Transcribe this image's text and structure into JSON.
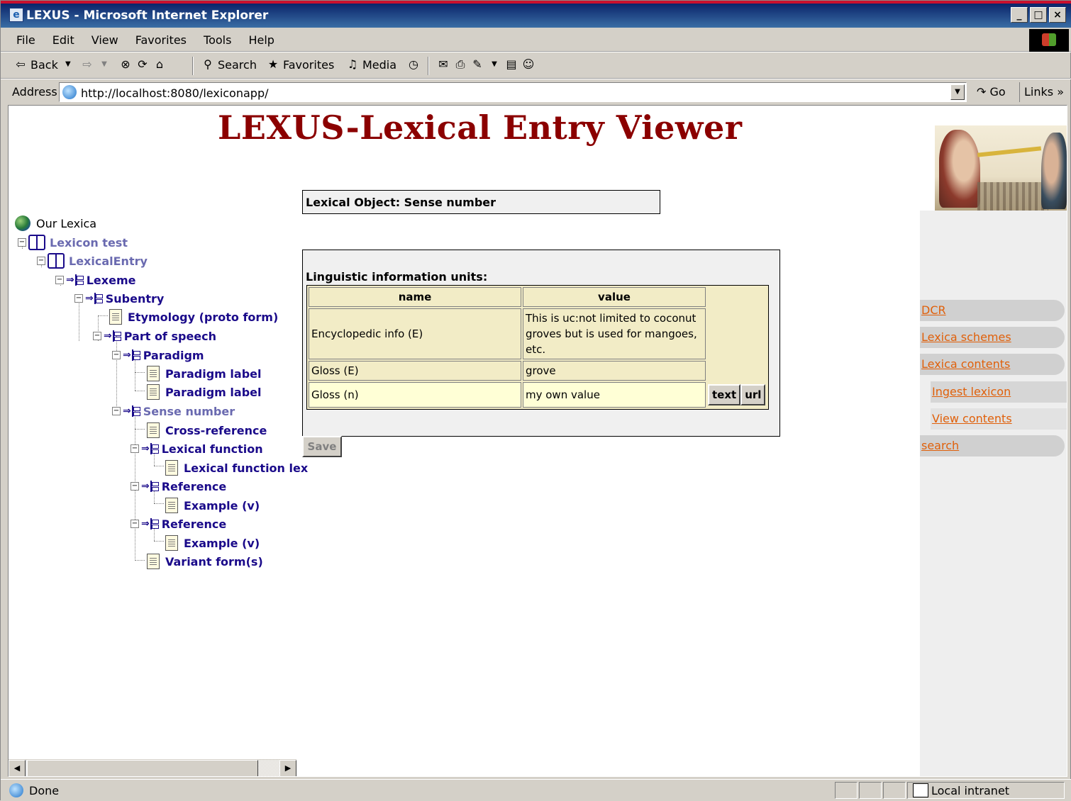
{
  "window": {
    "title": "LEXUS - Microsoft Internet Explorer",
    "controls": {
      "minimize": "_",
      "maximize": "□",
      "close": "×"
    }
  },
  "menubar": {
    "items": [
      "File",
      "Edit",
      "View",
      "Favorites",
      "Tools",
      "Help"
    ]
  },
  "toolbar": {
    "back": "Back",
    "search": "Search",
    "favorites": "Favorites",
    "media": "Media"
  },
  "addressbar": {
    "label": "Address",
    "url": "http://localhost:8080/lexiconapp/",
    "go": "Go",
    "links": "Links"
  },
  "page": {
    "title": "LEXUS-Lexical Entry Viewer"
  },
  "tree": {
    "root": "Our Lexica",
    "nodes": [
      {
        "label": "Lexicon test"
      },
      {
        "label": "LexicalEntry"
      },
      {
        "label": "Lexeme"
      },
      {
        "label": "Subentry"
      },
      {
        "label": "Etymology (proto form)"
      },
      {
        "label": "Part of speech"
      },
      {
        "label": "Paradigm"
      },
      {
        "label": "Paradigm label"
      },
      {
        "label": "Paradigm label"
      },
      {
        "label": "Sense number"
      },
      {
        "label": "Cross-reference"
      },
      {
        "label": "Lexical function"
      },
      {
        "label": "Lexical function lex"
      },
      {
        "label": "Reference"
      },
      {
        "label": "Example (v)"
      },
      {
        "label": "Reference"
      },
      {
        "label": "Example (v)"
      },
      {
        "label": "Variant form(s)"
      }
    ]
  },
  "lexical_object": {
    "label": "Lexical Object: Sense number"
  },
  "linguistic_units": {
    "caption": "Linguistic information units:",
    "columns": [
      "name",
      "value"
    ],
    "rows": [
      {
        "name": "Encyclopedic info (E)",
        "value": "This is uc:not limited to coconut groves but is used for mangoes, etc."
      },
      {
        "name": "Gloss (E)",
        "value": "grove"
      },
      {
        "name": "Gloss (n)",
        "value": "my own value"
      }
    ],
    "text_button": "text",
    "url_button": "url"
  },
  "save_button": "Save",
  "nav": {
    "items": [
      "DCR",
      "Lexica schemes",
      "Lexica contents",
      "Ingest lexicon",
      "View contents",
      "search"
    ]
  },
  "statusbar": {
    "status": "Done",
    "zone": "Local intranet"
  }
}
